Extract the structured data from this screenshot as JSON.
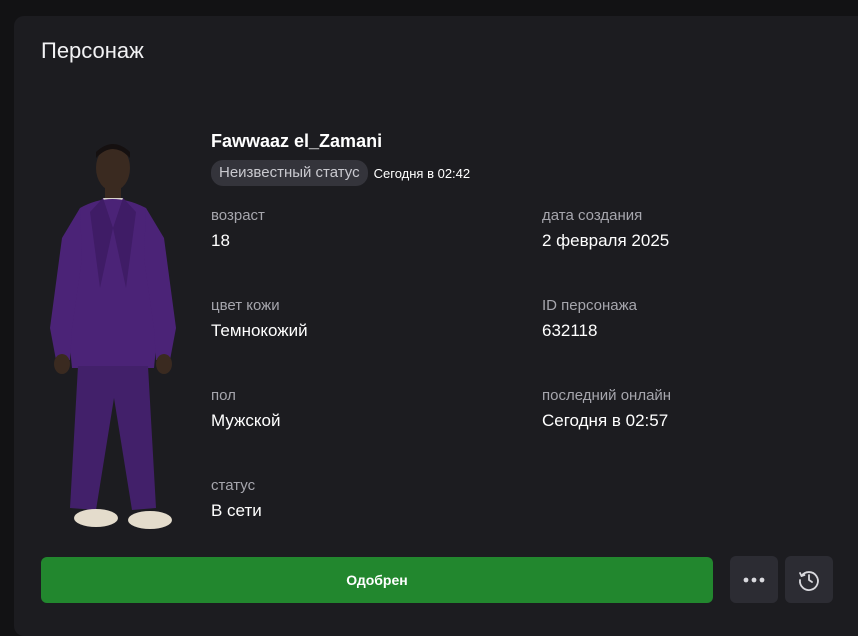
{
  "panel": {
    "title": "Персонаж"
  },
  "character": {
    "name": "Fawwaaz el_Zamani",
    "status_badge": "Неизвестный статус",
    "status_time": "Сегодня в 02:42"
  },
  "fields": {
    "age": {
      "label": "возраст",
      "value": "18"
    },
    "created": {
      "label": "дата создания",
      "value": "2 февраля 2025"
    },
    "skin": {
      "label": "цвет кожи",
      "value": "Темнокожий"
    },
    "id": {
      "label": "ID персонажа",
      "value": "632118"
    },
    "gender": {
      "label": "пол",
      "value": "Мужской"
    },
    "last_online": {
      "label": "последний онлайн",
      "value": "Сегодня в 02:57"
    },
    "status": {
      "label": "статус",
      "value": "В сети"
    }
  },
  "actions": {
    "approve_label": "Одобрен",
    "more_icon": "more-dots-icon",
    "history_icon": "history-clock-icon"
  },
  "colors": {
    "background": "#121214",
    "panel": "#1c1c20",
    "approve": "#22872e",
    "icon_button": "#2c2c33",
    "label": "#a6a6ad"
  }
}
